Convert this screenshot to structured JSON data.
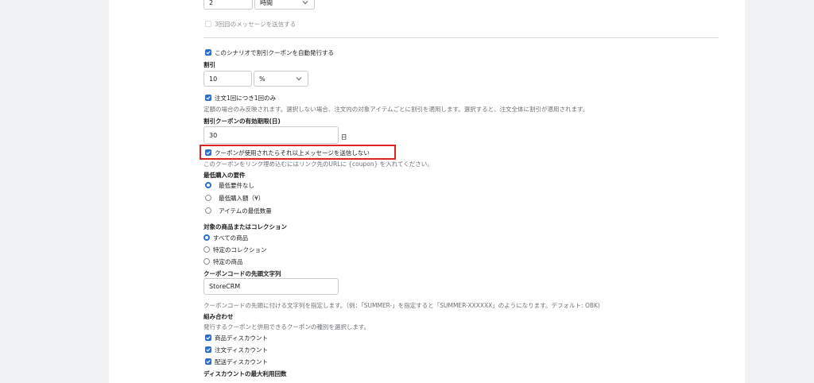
{
  "top": {
    "hours_value": "2",
    "hours_unit": "時間",
    "third_message_label": "3回目のメッセージを送信する"
  },
  "coupon": {
    "auto_issue_label": "このシナリオで割引クーポンを自動発行する",
    "discount_heading": "割引",
    "discount_value": "10",
    "discount_unit": "%",
    "once_per_order_label": "注文1回につき1回のみ",
    "once_per_order_help": "定額の場合のみ反映されます。選択しない場合、注文内の対象アイテムごとに割引を適用します。選択すると、注文全体に割引が適用されます。",
    "validity_heading": "割引クーポンの有効期限(日)",
    "validity_value": "30",
    "validity_unit": "日",
    "stop_after_use_label": "クーポンが使用されたらそれ以上メッセージを送信しない",
    "link_help": "このクーポンをリンク埋め込むにはリンク先のURLに {coupon} を入れてください。",
    "min_req_heading": "最低購入の要件",
    "min_req_options": [
      "最低要件なし",
      "最低購入額（¥）",
      "アイテムの最低数量"
    ],
    "target_heading": "対象の商品またはコレクション",
    "target_options": [
      "すべての商品",
      "特定のコレクション",
      "特定の商品"
    ],
    "prefix_heading": "クーポンコードの先頭文字列",
    "prefix_value": "StoreCRM",
    "prefix_help": "クーポンコードの先頭に付ける文字列を指定します。（例：「SUMMER-」を指定すると「SUMMER-XXXXXX」のようになります。デフォルト: OBK)",
    "combo_heading": "組み合わせ",
    "combo_help": "発行するクーポンと併用できるクーポンの種別を選択します。",
    "combo_options": [
      "商品ディスカウント",
      "注文ディスカウント",
      "配送ディスカウント"
    ],
    "max_usage_heading": "ディスカウントの最大利用回数"
  },
  "colors": {
    "accent": "#2c6ecb",
    "highlight_box": "#e02424",
    "side_background": "#f1f2f3"
  }
}
